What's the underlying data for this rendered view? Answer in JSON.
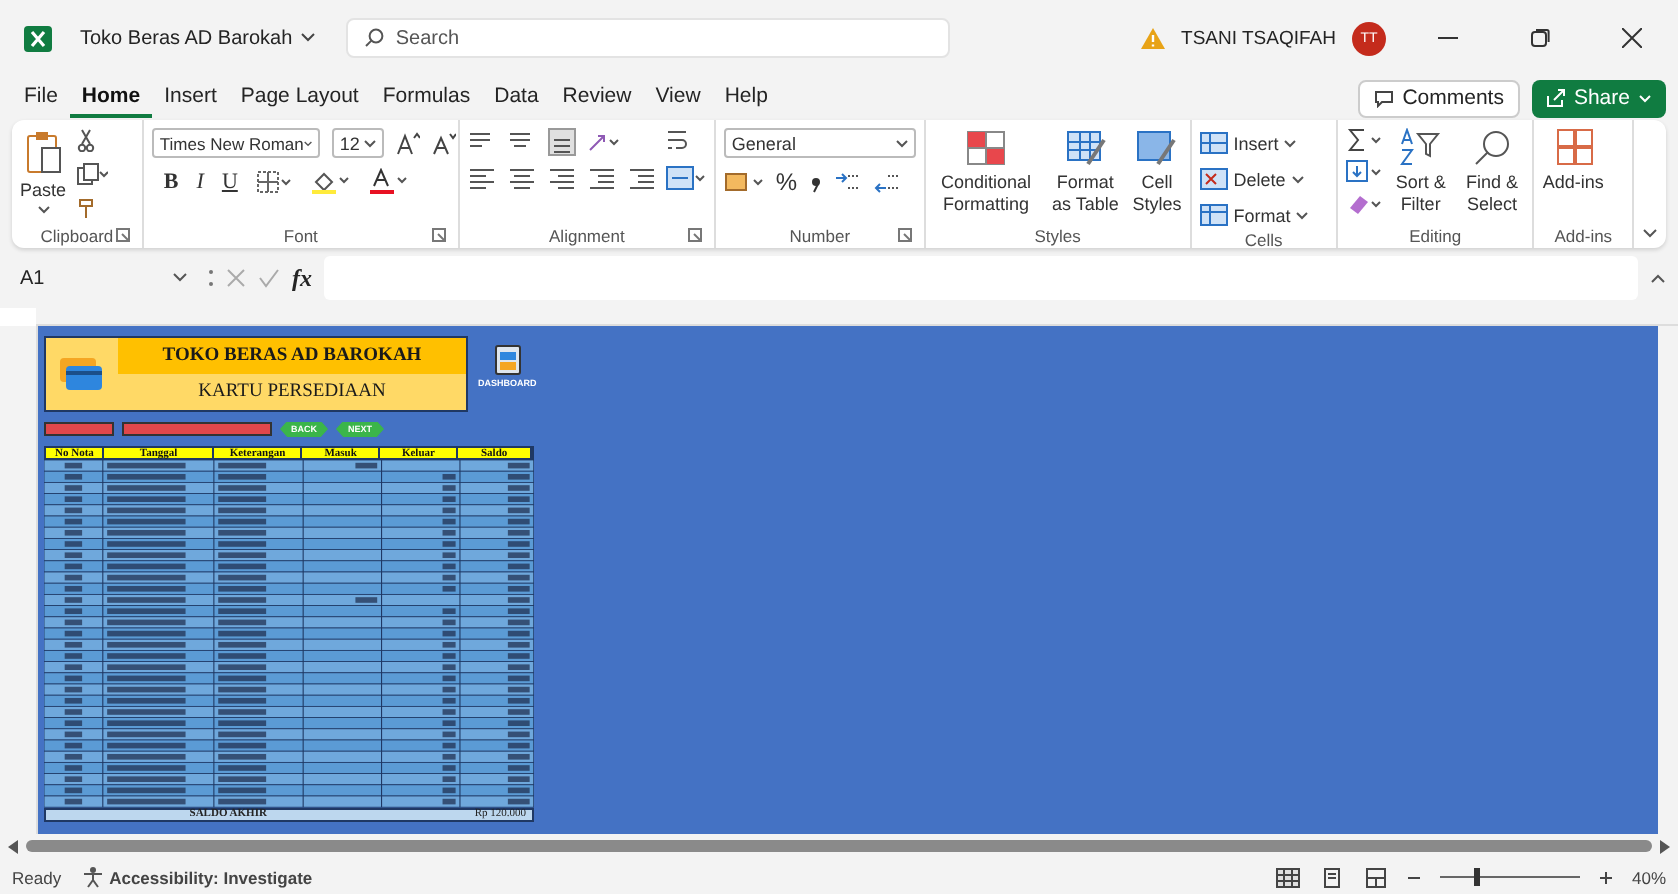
{
  "window": {
    "title": "Toko Beras AD Barokah",
    "search_placeholder": "Search",
    "user": "TSANI TSAQIFAH",
    "avatar_initials": "TT"
  },
  "menu_tabs": [
    {
      "label": "File",
      "selected": false
    },
    {
      "label": "Home",
      "selected": true
    },
    {
      "label": "Insert",
      "selected": false
    },
    {
      "label": "Page Layout",
      "selected": false
    },
    {
      "label": "Formulas",
      "selected": false
    },
    {
      "label": "Data",
      "selected": false
    },
    {
      "label": "Review",
      "selected": false
    },
    {
      "label": "View",
      "selected": false
    },
    {
      "label": "Help",
      "selected": false
    }
  ],
  "actions": {
    "comments": "Comments",
    "share": "Share"
  },
  "ribbon": {
    "clipboard": {
      "label": "Clipboard",
      "paste": "Paste"
    },
    "font": {
      "label": "Font",
      "font_name": "Times New Roman",
      "font_size": "12",
      "bold": "B",
      "italic": "I",
      "underline": "U"
    },
    "alignment": {
      "label": "Alignment"
    },
    "number": {
      "label": "Number",
      "format": "General",
      "percent": "%"
    },
    "styles": {
      "label": "Styles",
      "buttons": [
        "Conditional Formatting",
        "Format as Table",
        "Cell Styles"
      ]
    },
    "cells": {
      "label": "Cells",
      "buttons": [
        "Insert",
        "Delete",
        "Format"
      ]
    },
    "editing": {
      "label": "Editing",
      "buttons": [
        "Sort & Filter",
        "Find & Select"
      ]
    },
    "addins": {
      "label": "Add-ins",
      "buttons": [
        "Add-ins"
      ]
    }
  },
  "formula_bar": {
    "name_box": "A1",
    "fx": "fx"
  },
  "sheet": {
    "title": "TOKO BERAS AD BAROKAH",
    "subtitle": "KARTU PERSEDIAAN",
    "dashboard_label": "DASHBOARD",
    "back_button": "BACK",
    "next_button": "NEXT",
    "columns": [
      "No Nota",
      "Tanggal",
      "Keterangan",
      "Masuk",
      "Keluar",
      "Saldo"
    ],
    "footer_label": "SALDO AKHIR",
    "footer_value": "Rp 120.000"
  },
  "status_bar": {
    "status": "Ready",
    "accessibility": "Accessibility: Investigate",
    "zoom": "40%",
    "zoom_slider": {
      "level": 0.25
    }
  }
}
